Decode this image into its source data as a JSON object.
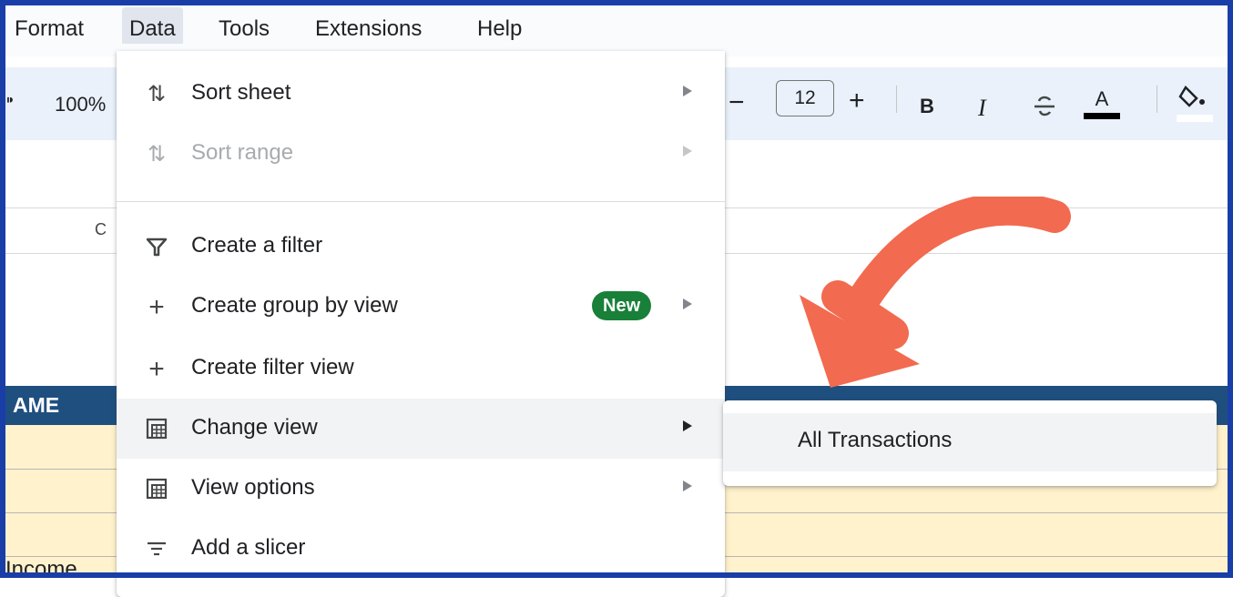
{
  "menubar": {
    "items": [
      "Format",
      "Data",
      "Tools",
      "Extensions",
      "Help"
    ]
  },
  "toolbar": {
    "zoom": "100%",
    "font_size": "12",
    "minus": "−",
    "plus": "+",
    "bold": "B",
    "italic": "I",
    "text_color_letter": "A"
  },
  "sheet": {
    "column_c": "C",
    "header_name": "AME",
    "income_cell": "Income"
  },
  "data_menu": {
    "items": [
      {
        "label": "Sort sheet",
        "icon": "sort-icon"
      },
      {
        "label": "Sort range",
        "icon": "sort-icon",
        "disabled": true
      },
      {
        "label": "Create a filter",
        "icon": "filter-icon"
      },
      {
        "label": "Create group by view",
        "icon": "plus-icon",
        "badge": "New"
      },
      {
        "label": "Create filter view",
        "icon": "plus-icon"
      },
      {
        "label": "Change view",
        "icon": "table-view-icon",
        "highlighted": true
      },
      {
        "label": "View options",
        "icon": "table-view-icon"
      },
      {
        "label": "Add a slicer",
        "icon": "slicer-icon"
      }
    ]
  },
  "change_view_submenu": {
    "items": [
      "All Transactions"
    ]
  },
  "colors": {
    "frame": "#1a3ea8",
    "header_band": "#1f4f7f",
    "yellow_band": "#fff2cc",
    "new_badge": "#188038",
    "annotation_arrow": "#f26a4f"
  }
}
